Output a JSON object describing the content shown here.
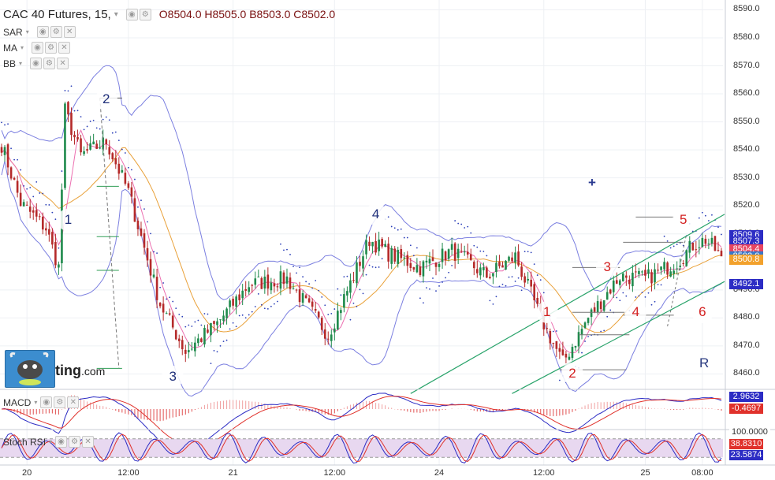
{
  "header": {
    "symbol": "CAC 40 Futures, 15,",
    "open": "O8504.0",
    "high": "H8505.0",
    "low": "B8503.0",
    "close": "C8502.0"
  },
  "indicators": [
    "SAR",
    "MA",
    "BB"
  ],
  "logo": {
    "text": "ting",
    "suffix": ".com"
  },
  "annotations": {
    "plus": "+",
    "r": "R"
  },
  "macd_panel": {
    "label": "MACD",
    "values": [
      "2.9632",
      "-0.4697"
    ]
  },
  "rsi_panel": {
    "label": "Stoch RSI",
    "values": [
      "100.0000",
      "38.8310",
      "23.5874"
    ]
  },
  "price_boxes": [
    {
      "text": "8509.6",
      "bg": "#2c2cc4"
    },
    {
      "text": "8507.3",
      "bg": "#2c2cc4"
    },
    {
      "text": "8504.4",
      "bg": "#e84560"
    },
    {
      "text": "8502.0",
      "bg": "#3a78c9"
    },
    {
      "text": "8500.8",
      "bg": "#f2a12c"
    },
    {
      "text": "8492.1",
      "bg": "#2c2cc4"
    }
  ],
  "colors": {
    "bull": "#1f8a4c",
    "bear": "#b52a2a",
    "band": "#7b7fe0",
    "sar": "#2b3fb8",
    "ma": "#e9a13a",
    "channel": "#29a36a",
    "wave_blue": "#1f2f7a",
    "wave_red": "#d31f1f"
  },
  "chart_data": {
    "type": "candlestick",
    "title": "CAC 40 Futures, 15,",
    "y_ticks": [
      8460.0,
      8470.0,
      8480.0,
      8490.0,
      8500.0,
      8510.0,
      8520.0,
      8530.0,
      8540.0,
      8550.0,
      8560.0,
      8570.0,
      8580.0,
      8590.0
    ],
    "y_tick_labels": [
      "8460.0",
      "8470.0",
      "8480.0",
      "8490.0",
      "8500.0",
      "8510.0",
      "8520.0",
      "8530.0",
      "8540.0",
      "8550.0",
      "8560.0",
      "8570.0",
      "8580.0",
      "8590.0"
    ],
    "ylim": [
      8454.5,
      8593.5
    ],
    "x_tick_labels": [
      "20",
      "12:00",
      "21",
      "12:00",
      "24",
      "12:00",
      "25",
      "08:00"
    ],
    "x_tick_positions": [
      8,
      40,
      73,
      105,
      138,
      171,
      203,
      221
    ],
    "n_bars": 228,
    "close_anchors": [
      [
        0,
        8542
      ],
      [
        6,
        8521
      ],
      [
        14,
        8512
      ],
      [
        18,
        8498
      ],
      [
        20,
        8554
      ],
      [
        25,
        8538
      ],
      [
        33,
        8543
      ],
      [
        40,
        8525
      ],
      [
        50,
        8485
      ],
      [
        58,
        8468
      ],
      [
        68,
        8478
      ],
      [
        78,
        8492
      ],
      [
        90,
        8494
      ],
      [
        103,
        8474
      ],
      [
        116,
        8508
      ],
      [
        122,
        8503
      ],
      [
        132,
        8498
      ],
      [
        142,
        8504
      ],
      [
        153,
        8495
      ],
      [
        162,
        8502
      ],
      [
        170,
        8480
      ],
      [
        177,
        8464
      ],
      [
        185,
        8480
      ],
      [
        195,
        8495
      ],
      [
        203,
        8494
      ],
      [
        213,
        8500
      ],
      [
        218,
        8506
      ],
      [
        222,
        8508
      ],
      [
        227,
        8502
      ]
    ],
    "last_ohlc": {
      "open": 8504.0,
      "high": 8505.0,
      "low": 8503.0,
      "close": 8502.0
    },
    "price_labels": [
      8509.6,
      8507.3,
      8504.4,
      8502.0,
      8500.8,
      8492.1
    ],
    "waves_blue": [
      {
        "label": "1",
        "bar": 21,
        "price": 8515
      },
      {
        "label": "2",
        "bar": 33,
        "price": 8558
      },
      {
        "label": "3",
        "bar": 54,
        "price": 8459
      },
      {
        "label": "4",
        "bar": 118,
        "price": 8517
      }
    ],
    "waves_red": [
      {
        "label": "1",
        "bar": 172,
        "price": 8482
      },
      {
        "label": "2",
        "bar": 180,
        "price": 8460
      },
      {
        "label": "3",
        "bar": 191,
        "price": 8498
      },
      {
        "label": "4",
        "bar": 200,
        "price": 8482
      },
      {
        "label": "5",
        "bar": 215,
        "price": 8515
      },
      {
        "label": "6",
        "bar": 221,
        "price": 8482
      }
    ],
    "channel_lines": [
      {
        "from": [
          129,
          8453
        ],
        "to": [
          228,
          8517
        ]
      },
      {
        "from": [
          161,
          8453
        ],
        "to": [
          228,
          8493
        ]
      }
    ],
    "horizontal_levels": [
      {
        "bar_from": 31,
        "bar_to": 38,
        "price": 8558.5
      },
      {
        "bar_from": 30,
        "bar_to": 37,
        "price": 8527
      },
      {
        "bar_from": 30,
        "bar_to": 37,
        "price": 8509
      },
      {
        "bar_from": 30,
        "bar_to": 38,
        "price": 8462
      },
      {
        "bar_from": 30,
        "bar_to": 37,
        "price": 8497
      },
      {
        "bar_from": 176,
        "bar_to": 197,
        "price": 8461.5
      },
      {
        "bar_from": 180,
        "bar_to": 195,
        "price": 8498
      },
      {
        "bar_from": 180,
        "bar_to": 197,
        "price": 8482
      },
      {
        "bar_from": 182,
        "bar_to": 198,
        "price": 8474
      },
      {
        "bar_from": 196,
        "bar_to": 212,
        "price": 8481
      },
      {
        "bar_from": 200,
        "bar_to": 212,
        "price": 8516
      },
      {
        "bar_from": 196,
        "bar_to": 215,
        "price": 8507
      }
    ],
    "macd": {
      "range": [
        -6,
        6
      ],
      "values": [
        2.9632,
        -0.4697
      ]
    },
    "stoch_rsi": {
      "range": [
        0,
        100
      ],
      "values": [
        100.0,
        38.831,
        23.5874
      ],
      "band": [
        20,
        80
      ]
    }
  }
}
